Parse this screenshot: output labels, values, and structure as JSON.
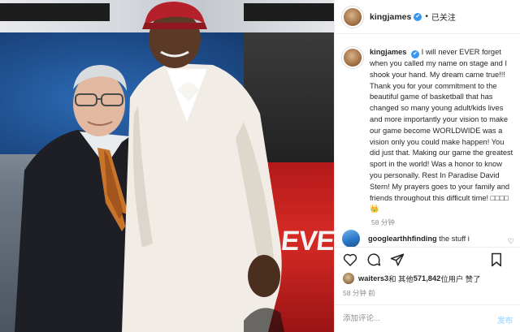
{
  "post": {
    "username": "kingjames",
    "verified_glyph": "✔",
    "separator": "•",
    "follow_status": "已关注",
    "caption": "I will never EVER forget when you called my name on stage and I shook your hand. My dream came true!!! Thank you for your commitment to the beautiful game of basketball that has changed so many young adult/kids lives and more importantly your vision to make our game become WORLDWIDE was a vision only you could make happen! You did just that. Making our game the greatest sport in the world! Was a honor to know you personally. Rest In Paradise David Stern! My prayers goes to your family and friends throughout this difficult time! ",
    "caption_emojis": "□□□□👑",
    "caption_time": "58 分钟"
  },
  "comment": {
    "username": "googlearthhfinding",
    "text": "the stuff i",
    "heart_glyph": "♡"
  },
  "likes": {
    "liker": "waiters3",
    "middle": " 和 其他 ",
    "count": "571,842",
    "suffix": " 位用户 赞了"
  },
  "post_time": "58 分钟 前",
  "add_comment": {
    "placeholder": "添加评论...",
    "post_label": "发布"
  },
  "photo": {
    "sign_text": "EVER"
  },
  "icons": {
    "avatar": "profile-avatar",
    "like": "heart-icon",
    "comment": "comment-bubble-icon",
    "share": "paper-plane-icon",
    "save": "bookmark-icon"
  },
  "colors": {
    "verified": "#3897f0",
    "meta_text": "#8e8e8e",
    "post_button_disabled": "#b2dffc"
  }
}
